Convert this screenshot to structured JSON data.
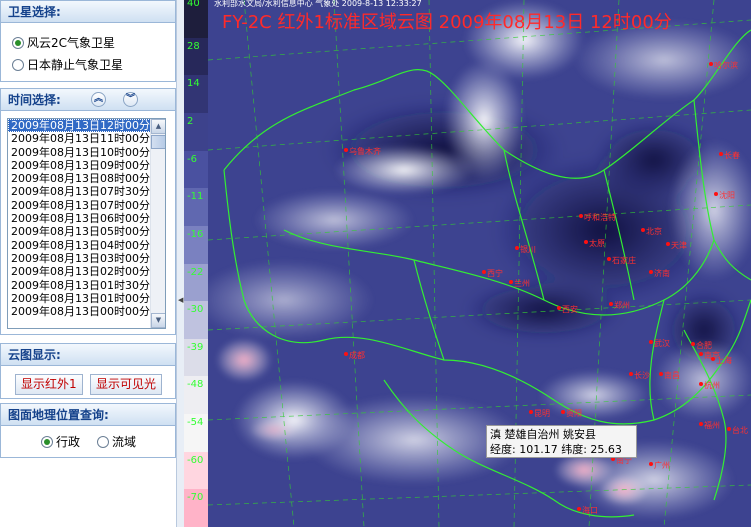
{
  "satellite_panel": {
    "title": "卫星选择:",
    "options": [
      {
        "label": "风云2C气象卫星",
        "selected": true
      },
      {
        "label": "日本静止气象卫星",
        "selected": false
      }
    ]
  },
  "time_panel": {
    "title": "时间选择:",
    "up_label": "︽",
    "down_label": "︾",
    "items": [
      "2009年08月13日12时00分",
      "2009年08月13日11时00分",
      "2009年08月13日10时00分",
      "2009年08月13日09时00分",
      "2009年08月13日08时00分",
      "2009年08月13日07时30分",
      "2009年08月13日07时00分",
      "2009年08月13日06时00分",
      "2009年08月13日05时00分",
      "2009年08月13日04时00分",
      "2009年08月13日03时00分",
      "2009年08月13日02时00分",
      "2009年08月13日01时30分",
      "2009年08月13日01时00分",
      "2009年08月13日00时00分"
    ],
    "selected_index": 0
  },
  "cloud_panel": {
    "title": "云图显示:",
    "infrared_button": "显示红外1",
    "visible_button": "显示可见光"
  },
  "geo_panel": {
    "title": "图面地理位置查询:",
    "options": [
      {
        "label": "行政",
        "selected": true
      },
      {
        "label": "流域",
        "selected": false
      }
    ]
  },
  "map": {
    "header_small": "水利部水文局/水利信息中心  气象处     2009-8-13 12:33:27",
    "title": "FY-2C 红外1标准区域云图 2009年08月13日 12时00分",
    "colorbar_labels": [
      "40",
      "28",
      "14",
      "2",
      "-6",
      "-11",
      "-16",
      "-22",
      "-30",
      "-39",
      "-48",
      "-54",
      "-60",
      "-70"
    ],
    "cities": [
      "乌鲁木齐",
      "呼和浩特",
      "北京",
      "太原",
      "石家庄",
      "济南",
      "银川",
      "西宁",
      "兰州",
      "西安",
      "郑州",
      "成都",
      "武汉",
      "合肥",
      "南京",
      "上海",
      "杭州",
      "长沙",
      "南昌",
      "福州",
      "台北",
      "贵阳",
      "昆明",
      "南宁",
      "广州",
      "海口",
      "沈阳",
      "长春",
      "哈尔滨",
      "天津"
    ],
    "tooltip": {
      "location": "滇 楚雄自治州 姚安县",
      "coords": "经度: 101.17 纬度: 25.63"
    }
  }
}
